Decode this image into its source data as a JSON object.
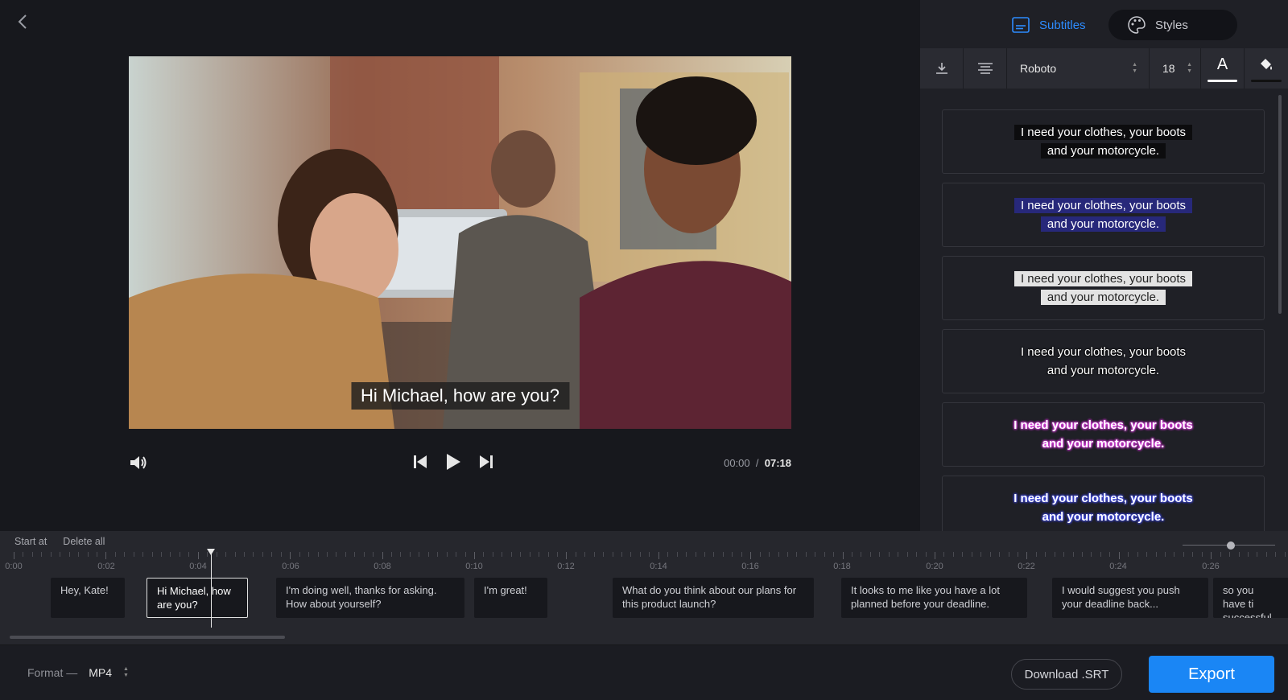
{
  "player": {
    "caption": "Hi Michael, how are you?",
    "current_time": "00:00",
    "separator": "/",
    "duration": "07:18"
  },
  "panel": {
    "tabs": [
      {
        "label": "Subtitles",
        "active": true,
        "icon": "subtitles-icon"
      },
      {
        "label": "Styles",
        "active": false,
        "icon": "palette-icon"
      }
    ],
    "toolbar": {
      "font": "Roboto",
      "size": "18",
      "text_color_label": "A"
    },
    "style_presets": [
      {
        "line1": "I need your clothes, your boots",
        "line2": "and your motorcycle."
      },
      {
        "line1": "I need your clothes, your boots",
        "line2": "and your motorcycle."
      },
      {
        "line1": "I need your clothes, your boots",
        "line2": "and your motorcycle."
      },
      {
        "line1": "I need your clothes, your boots",
        "line2": "and your motorcycle."
      },
      {
        "line1": "I need your clothes, your boots",
        "line2": "and your motorcycle."
      },
      {
        "line1": "I need your clothes, your boots",
        "line2": "and your motorcycle."
      }
    ]
  },
  "timeline": {
    "actions": [
      "Start at",
      "Delete all"
    ],
    "ticks": [
      "0:00",
      "0:02",
      "0:04",
      "0:06",
      "0:08",
      "0:10",
      "0:12",
      "0:14",
      "0:16",
      "0:18",
      "0:20",
      "0:22",
      "0:24",
      "0:26"
    ],
    "clips": [
      {
        "text": "Hey, Kate!"
      },
      {
        "text": "Hi Michael, how are you?",
        "selected": true
      },
      {
        "text": "I'm doing well, thanks for asking. How about yourself?"
      },
      {
        "text": "I'm great!"
      },
      {
        "text": "What do you think about our plans for this product launch?"
      },
      {
        "text": "It looks to me like you have a lot planned before your deadline."
      },
      {
        "text": "I would suggest you push your deadline back..."
      },
      {
        "text": "so you have ti successful ad"
      }
    ]
  },
  "footer": {
    "format_label": "Format —",
    "format_value": "MP4",
    "download_label": "Download .SRT",
    "export_label": "Export"
  },
  "colors": {
    "accent": "#1a86f5",
    "background": "#17181d",
    "panel": "#1f2026"
  }
}
